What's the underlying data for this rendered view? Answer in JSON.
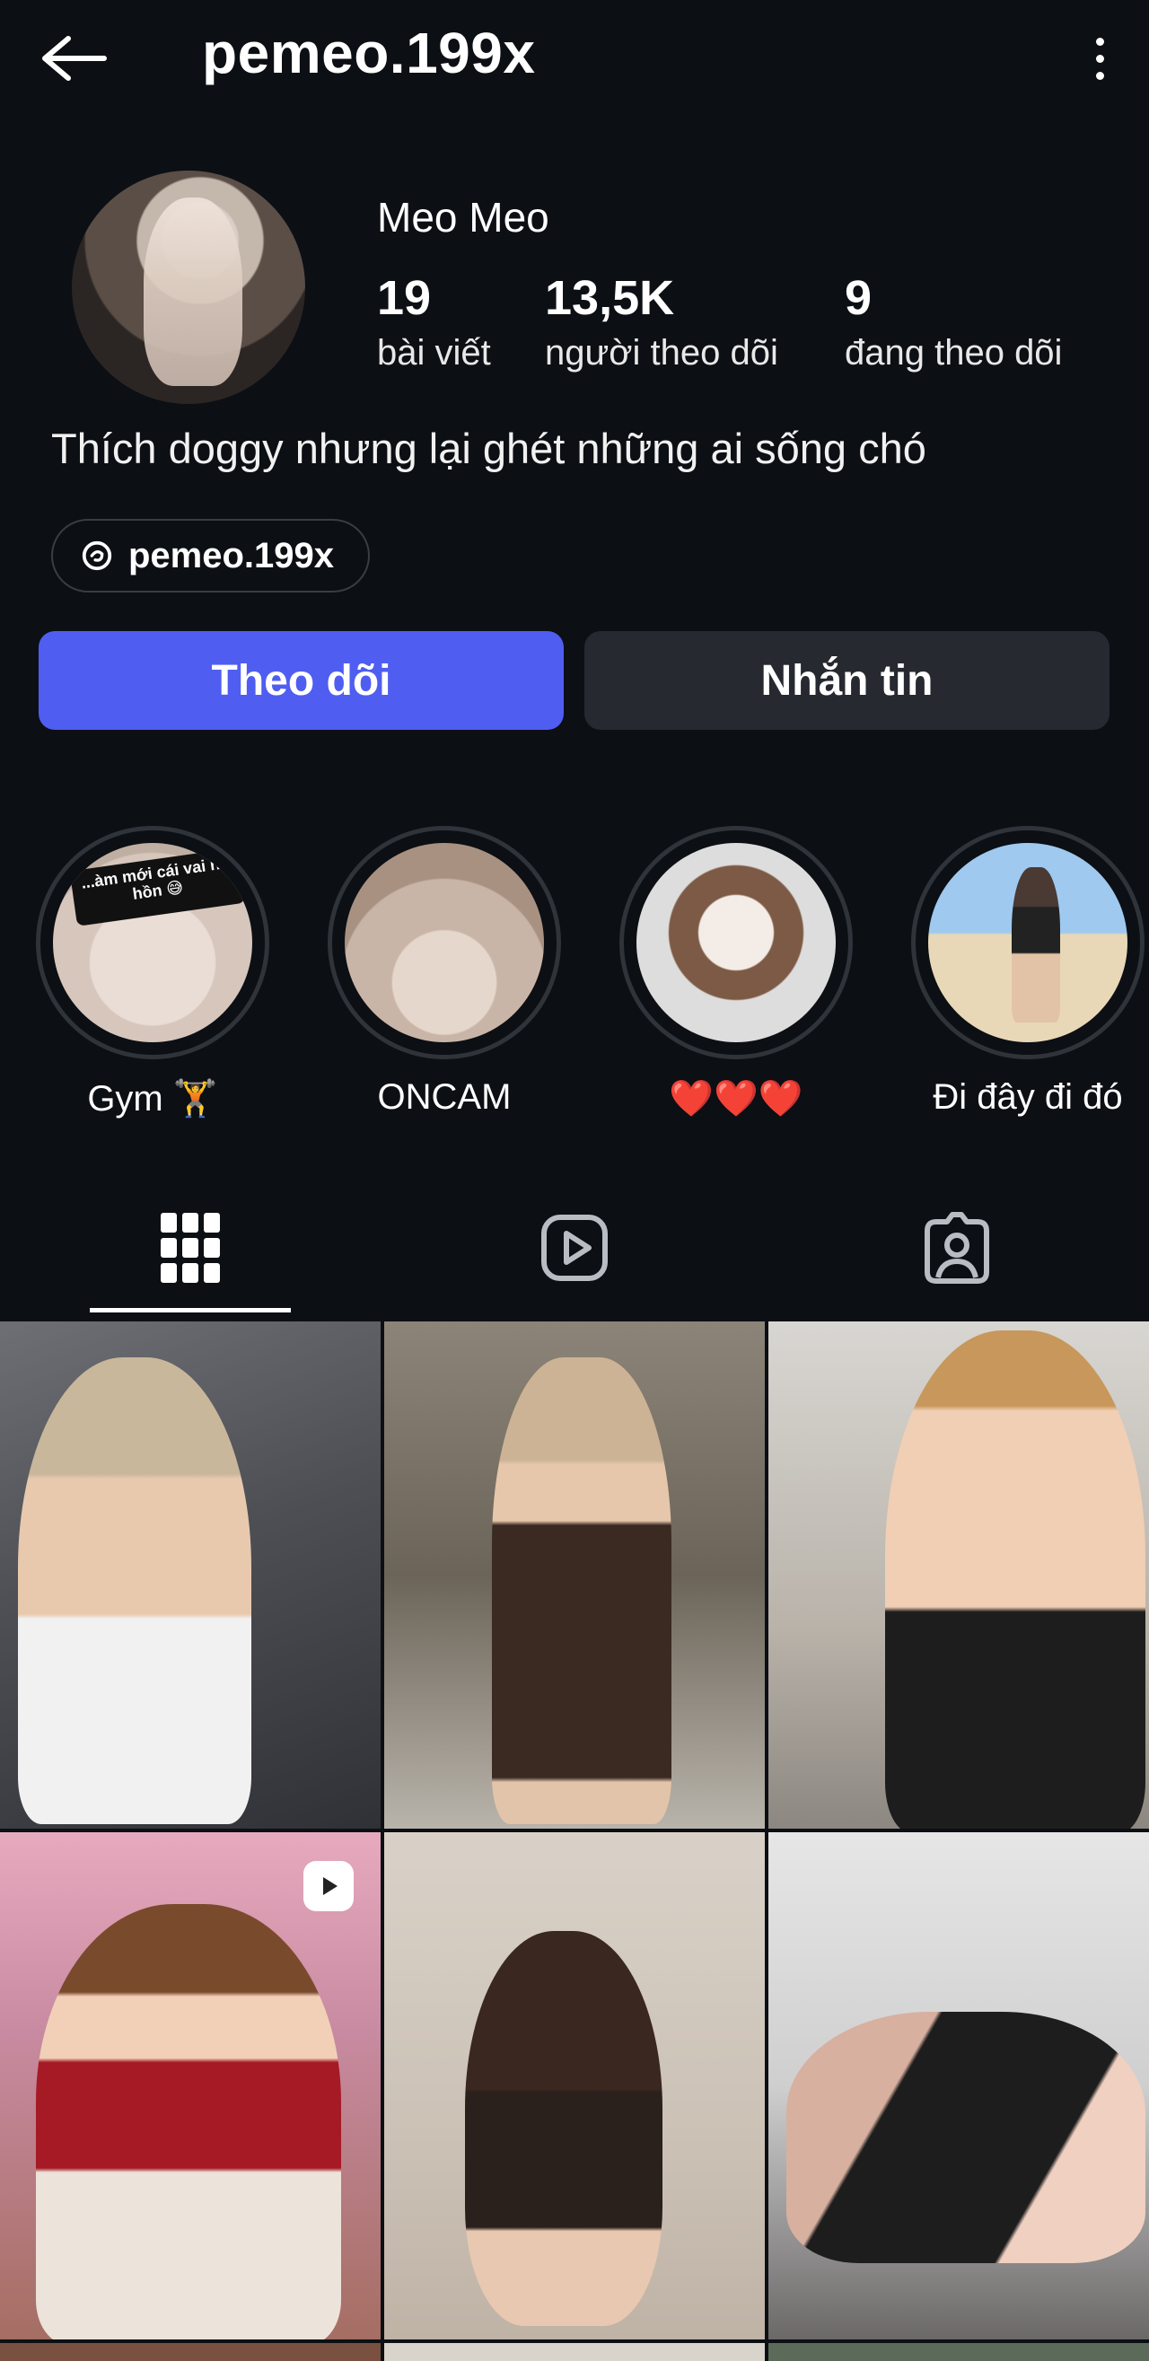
{
  "header": {
    "username": "pemeo.199x",
    "back_icon": "arrow-left-icon",
    "more_icon": "vertical-dots-icon"
  },
  "profile": {
    "display_name": "Meo Meo",
    "stats": [
      {
        "value": "19",
        "label": "bài viết"
      },
      {
        "value": "13,5K",
        "label": "người theo dõi"
      },
      {
        "value": "9",
        "label": "đang theo dõi"
      }
    ],
    "bio": "Thích doggy nhưng lại ghét những ai sống chó",
    "threads_handle": "pemeo.199x"
  },
  "actions": {
    "follow_label": "Theo dõi",
    "message_label": "Nhắn tin",
    "follow_color": "#4f5ef0",
    "message_color": "#26292f"
  },
  "highlights": [
    {
      "label": "Gym 🏋️",
      "overlay_text": "...àm mới cái vai hú hồn 😅"
    },
    {
      "label": "ONCAM"
    },
    {
      "label": "❤️❤️❤️"
    },
    {
      "label": "Đi đây đi đó"
    }
  ],
  "tabs": [
    {
      "name": "posts-grid",
      "icon": "grid-icon",
      "active": true
    },
    {
      "name": "reels",
      "icon": "reels-play-icon",
      "active": false
    },
    {
      "name": "tagged",
      "icon": "tagged-person-icon",
      "active": false
    }
  ],
  "theme": {
    "background": "#0c0f14",
    "text": "#ffffff"
  }
}
